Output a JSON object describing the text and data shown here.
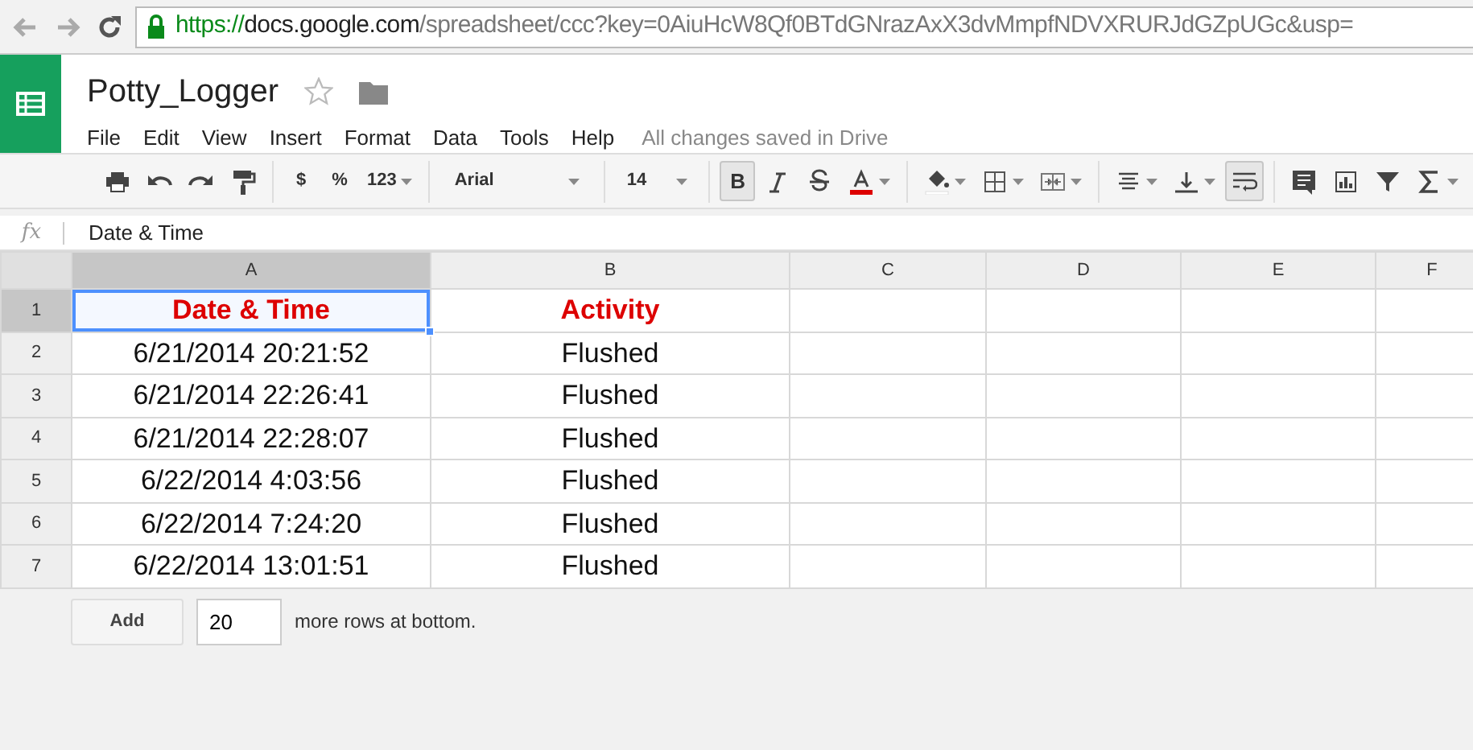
{
  "browser": {
    "url_scheme": "https://",
    "url_host": "docs.google.com",
    "url_path": "/spreadsheet/ccc?key=0AiuHcW8Qf0BTdGNrazAxX3dvMmpfNDVXRURJdGZpUGc&usp="
  },
  "doc": {
    "title": "Potty_Logger",
    "starred": false
  },
  "menu": [
    "File",
    "Edit",
    "View",
    "Insert",
    "Format",
    "Data",
    "Tools",
    "Help"
  ],
  "save_status": "All changes saved in Drive",
  "toolbar": [
    [
      {
        "kind": "icon",
        "pressed": false
      },
      {
        "kind": "icon",
        "pressed": false
      },
      {
        "kind": "icon",
        "pressed": false
      },
      {
        "kind": "icon",
        "pressed": false
      }
    ],
    [
      {
        "kind": "text",
        "label": "$",
        "pressed": false
      },
      {
        "kind": "text",
        "label": "%",
        "pressed": false
      },
      {
        "kind": "dropdown",
        "label": "123",
        "pressed": false
      }
    ],
    [
      {
        "kind": "font",
        "label": "Arial",
        "pressed": false
      }
    ],
    [
      {
        "kind": "size",
        "label": "14",
        "pressed": false
      }
    ],
    [
      {
        "kind": "text",
        "label": "B",
        "pressed": true
      },
      {
        "kind": "icon",
        "pressed": false
      },
      {
        "kind": "icon",
        "pressed": false
      },
      {
        "kind": "icon",
        "pressed": false,
        "color": "#dd0000"
      }
    ],
    [
      {
        "kind": "icon",
        "pressed": false
      },
      {
        "kind": "icon",
        "pressed": false
      },
      {
        "kind": "icon",
        "pressed": false
      }
    ],
    [
      {
        "kind": "icon",
        "pressed": false
      },
      {
        "kind": "icon",
        "pressed": false
      },
      {
        "kind": "icon",
        "pressed": true
      }
    ],
    [
      {
        "kind": "icon",
        "pressed": false
      },
      {
        "kind": "icon",
        "pressed": false
      },
      {
        "kind": "icon",
        "pressed": false
      },
      {
        "kind": "icon",
        "pressed": false
      }
    ]
  ],
  "formula_bar": {
    "label": "fx",
    "value": "Date & Time"
  },
  "sheet": {
    "columns": [
      {
        "label": "A",
        "selected": true
      },
      {
        "label": "B",
        "selected": false
      },
      {
        "label": "C",
        "selected": false
      },
      {
        "label": "D",
        "selected": false
      },
      {
        "label": "E",
        "selected": false
      },
      {
        "label": "F",
        "selected": false
      }
    ],
    "rows": [
      {
        "number": "1",
        "kind": "header",
        "selected": true,
        "cells": [
          {
            "text": "Date & Time",
            "selected": true
          },
          {
            "text": "Activity",
            "selected": false
          }
        ]
      },
      {
        "number": "2",
        "kind": "data",
        "selected": false,
        "cells": [
          {
            "text": "6/21/2014 20:21:52",
            "selected": false
          },
          {
            "text": "Flushed",
            "selected": false
          }
        ]
      },
      {
        "number": "3",
        "kind": "data",
        "selected": false,
        "cells": [
          {
            "text": "6/21/2014 22:26:41",
            "selected": false
          },
          {
            "text": "Flushed",
            "selected": false
          }
        ]
      },
      {
        "number": "4",
        "kind": "data",
        "selected": false,
        "cells": [
          {
            "text": "6/21/2014 22:28:07",
            "selected": false
          },
          {
            "text": "Flushed",
            "selected": false
          }
        ]
      },
      {
        "number": "5",
        "kind": "data",
        "selected": false,
        "cells": [
          {
            "text": "6/22/2014 4:03:56",
            "selected": false
          },
          {
            "text": "Flushed",
            "selected": false
          }
        ]
      },
      {
        "number": "6",
        "kind": "data",
        "selected": false,
        "cells": [
          {
            "text": "6/22/2014 7:24:20",
            "selected": false
          },
          {
            "text": "Flushed",
            "selected": false
          }
        ]
      },
      {
        "number": "7",
        "kind": "data",
        "selected": false,
        "cells": [
          {
            "text": "6/22/2014 13:01:51",
            "selected": false
          },
          {
            "text": "Flushed",
            "selected": false
          }
        ]
      }
    ]
  },
  "add_rows": {
    "button": "Add",
    "count": "20",
    "suffix": "more rows at bottom."
  }
}
